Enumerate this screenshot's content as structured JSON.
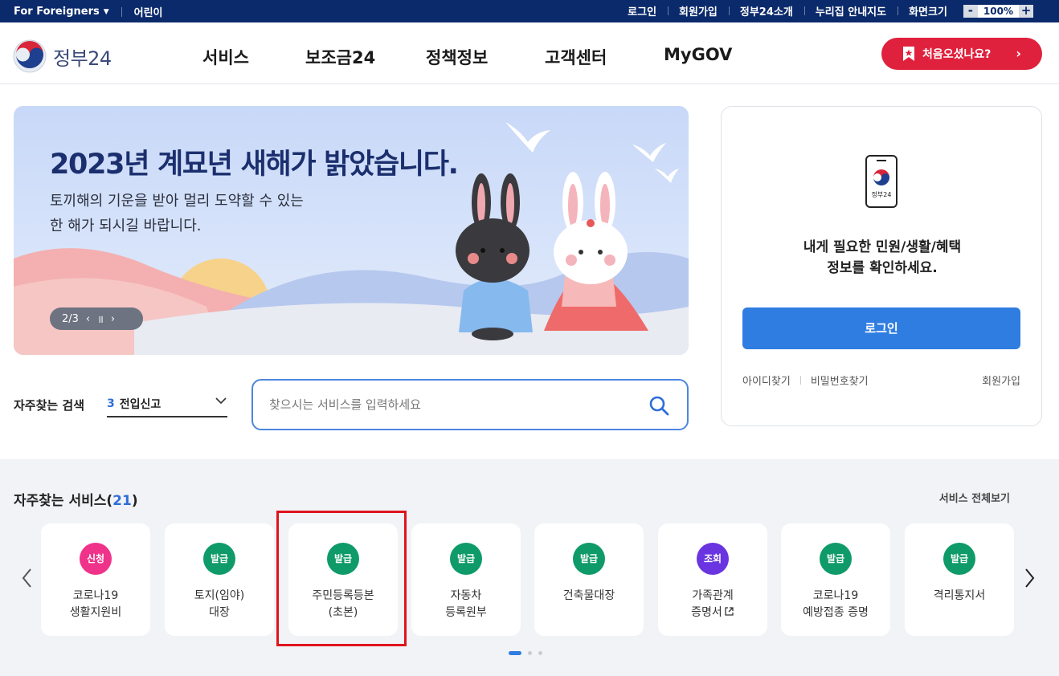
{
  "topbar": {
    "foreigners": "For Foreigners",
    "kids": "어린이",
    "links": [
      "로그인",
      "회원가입",
      "정부24소개",
      "누리집 안내지도"
    ],
    "zoom_label": "화면크기",
    "zoom_minus": "-",
    "zoom_value": "100%",
    "zoom_plus": "+"
  },
  "header": {
    "logo_text": "정부24",
    "nav": [
      "서비스",
      "보조금24",
      "정책정보",
      "고객센터",
      "MyGOV"
    ],
    "cta_label": "처음오셨나요?",
    "cta_chevron": "›"
  },
  "banner": {
    "title": "2023년 계묘년 새해가 밝았습니다.",
    "line1": "토끼해의 기운을 받아 멀리 도약할 수 있는",
    "line2": "한 해가 되시길 바랍니다.",
    "pager": "2/3",
    "prev": "‹",
    "pause": "॥",
    "next": "›"
  },
  "login": {
    "phone_text": "정부24",
    "message_line1": "내게 필요한 민원/생활/혜택",
    "message_line2": "정보를 확인하세요.",
    "button": "로그인",
    "find_id": "아이디찾기",
    "find_pw": "비밀번호찾기",
    "join": "회원가입"
  },
  "frequent_search": {
    "label": "자주찾는 검색",
    "selected_num": "3",
    "selected_text": "전입신고",
    "placeholder": "찾으시는 서비스를 입력하세요"
  },
  "services": {
    "title": "자주찾는 서비스(",
    "count": "21",
    "title_end": ")",
    "view_all": "서비스 전체보기",
    "items": [
      {
        "badge": "신청",
        "line1": "코로나19",
        "line2": "생활지원비",
        "color": "#f0338a"
      },
      {
        "badge": "발급",
        "line1": "토지(임야)",
        "line2": "대장",
        "color": "#0f9a6a"
      },
      {
        "badge": "발급",
        "line1": "주민등록등본",
        "line2": "(초본)",
        "color": "#0f9a6a"
      },
      {
        "badge": "발급",
        "line1": "자동차",
        "line2": "등록원부",
        "color": "#0f9a6a"
      },
      {
        "badge": "발급",
        "line1": "건축물대장",
        "line2": "",
        "color": "#0f9a6a"
      },
      {
        "badge": "조회",
        "line1": "가족관계",
        "line2": "증명서",
        "color": "#6a35e0"
      },
      {
        "badge": "발급",
        "line1": "코로나19",
        "line2": "예방접종 증명",
        "color": "#0f9a6a"
      },
      {
        "badge": "발급",
        "line1": "격리통지서",
        "line2": "",
        "color": "#0f9a6a"
      }
    ]
  },
  "colors": {
    "topbar": "#0b2a6b",
    "cta": "#e0213d",
    "primary_blue": "#2f7de1",
    "highlight": "#e0141e"
  }
}
